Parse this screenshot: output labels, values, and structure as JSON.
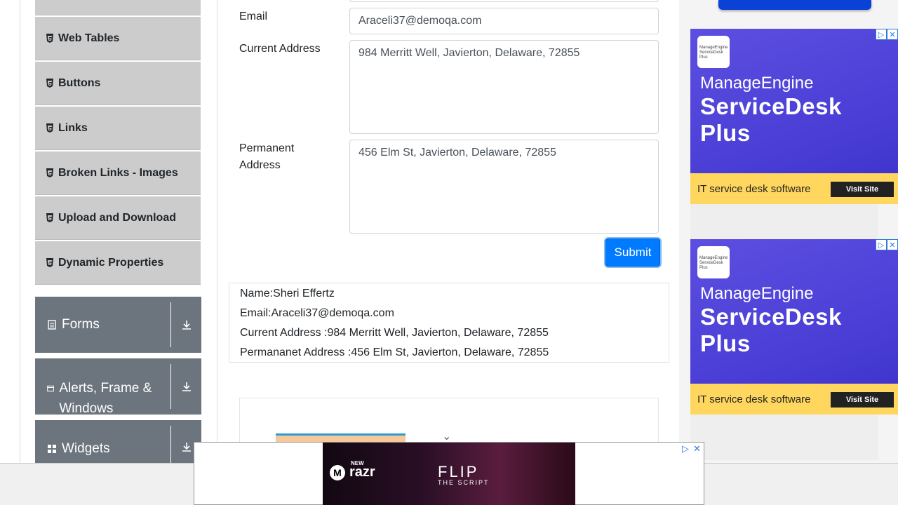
{
  "sidebar": {
    "items": [
      {
        "label": "Web Tables"
      },
      {
        "label": "Buttons"
      },
      {
        "label": "Links"
      },
      {
        "label": "Broken Links - Images"
      },
      {
        "label": "Upload and Download"
      },
      {
        "label": "Dynamic Properties"
      }
    ],
    "groups": [
      {
        "label": "Forms",
        "icon": "document-icon"
      },
      {
        "label": "Alerts, Frame & Windows",
        "icon": "window-icon"
      },
      {
        "label": "Widgets",
        "icon": "grid-icon"
      }
    ]
  },
  "form": {
    "email_label": "Email",
    "email_value": "Araceli37@demoqa.com",
    "current_address_label": "Current Address",
    "current_address_value": "984 Merritt Well, Javierton, Delaware, 72855",
    "permanent_address_label": "Permanent Address",
    "permanent_address_value": "456 Elm St, Javierton, Delaware, 72855",
    "submit_label": "Submit"
  },
  "output": {
    "name": "Name:Sheri Effertz",
    "email": "Email:Araceli37@demoqa.com",
    "current_address": "Current Address :984 Merritt Well, Javierton, Delaware, 72855",
    "permanent_address": "Permananet Address :456 Elm St, Javierton, Delaware, 72855"
  },
  "ads": {
    "brand_small": "ManageEngine ServiceDesk Plus",
    "brand": "ManageEngine",
    "product": "ServiceDesk Plus",
    "tagline": "IT service desk software",
    "cta": "Visit Site",
    "banner_brand": "razr",
    "banner_brand_prefix": "NEW",
    "banner_title": "FLIP",
    "banner_sub": "THE SCRIPT"
  },
  "colors": {
    "primary": "#007bff",
    "sidebar_item_bg": "#cccccc",
    "group_bg": "#6c757d",
    "ad_bg": "#4a3ed6",
    "ad_footer": "#ffd75e"
  }
}
